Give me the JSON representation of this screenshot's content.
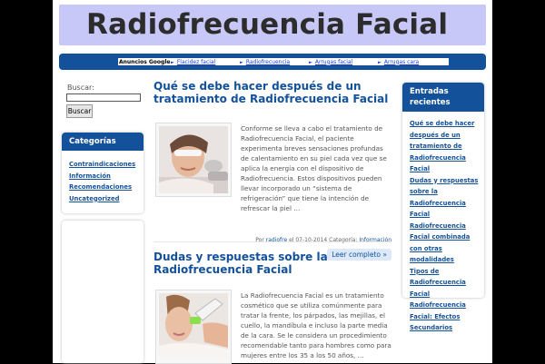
{
  "header": {
    "site_title": "Radiofrecuencia Facial"
  },
  "ad_bar": {
    "label": "Anuncios Google",
    "links": [
      "Flacidez facial",
      "Radiofrecuencia",
      "Arrugas facial",
      "Arrugas cara"
    ]
  },
  "search": {
    "label": "Buscar:",
    "value": "",
    "button_label": "Buscar"
  },
  "categories": {
    "title": "Categorías",
    "items": [
      "Contraindicaciones",
      "Información",
      "Recomendaciones",
      "Uncategorized"
    ]
  },
  "posts": [
    {
      "title": "Qué se debe hacer después de un tratamiento de Radiofrecuencia Facial",
      "excerpt": "Conforme se lleva a cabo el tratamiento de Radiofrecuencia Facial, el paciente experimenta breves sensaciones profundas de calentamiento en su piel cada vez que se aplica la energía con el dispositivo de Radiofrecuencia. Estos dispositivos pueden llevar incorporado un “sistema de refrigeración” que tiene la intención de refrescar la piel …",
      "meta_prefix": "Por",
      "author": "radiofre",
      "date": "el 07-10-2014",
      "category_label": "Categoría:",
      "category": "Información",
      "read_more": "Leer completo »"
    },
    {
      "title": "Dudas y respuestas sobre la Radiofrecuencia Facial",
      "excerpt": "La Radiofrecuencia Facial es un tratamiento cosmético que se utiliza comúnmente para tratar la frente, los párpados, las mejillas, el cuello, la mandíbula e incluso la parte media de la cara. Se le considera un procedimiento recomendable tanto para hombres como para mujeres entre los 35 a los 50 años, …"
    }
  ],
  "recent": {
    "title": "Entradas recientes",
    "items": [
      "Qué se debe hacer después de un tratamiento de Radiofrecuencia Facial",
      "Dudas y respuestas sobre la Radiofrecuencia Facial",
      "Radiofrecuencia Facial combinada con otras modalidades",
      "Tipos de Radiofrecuencia Facial",
      "Radiofrecuencia Facial: Efectos Secundarios"
    ]
  },
  "colors": {
    "accent": "#13519a",
    "header_bg": "#c8c8f8",
    "ad_link": "#1a3fd6",
    "text": "#555555"
  }
}
